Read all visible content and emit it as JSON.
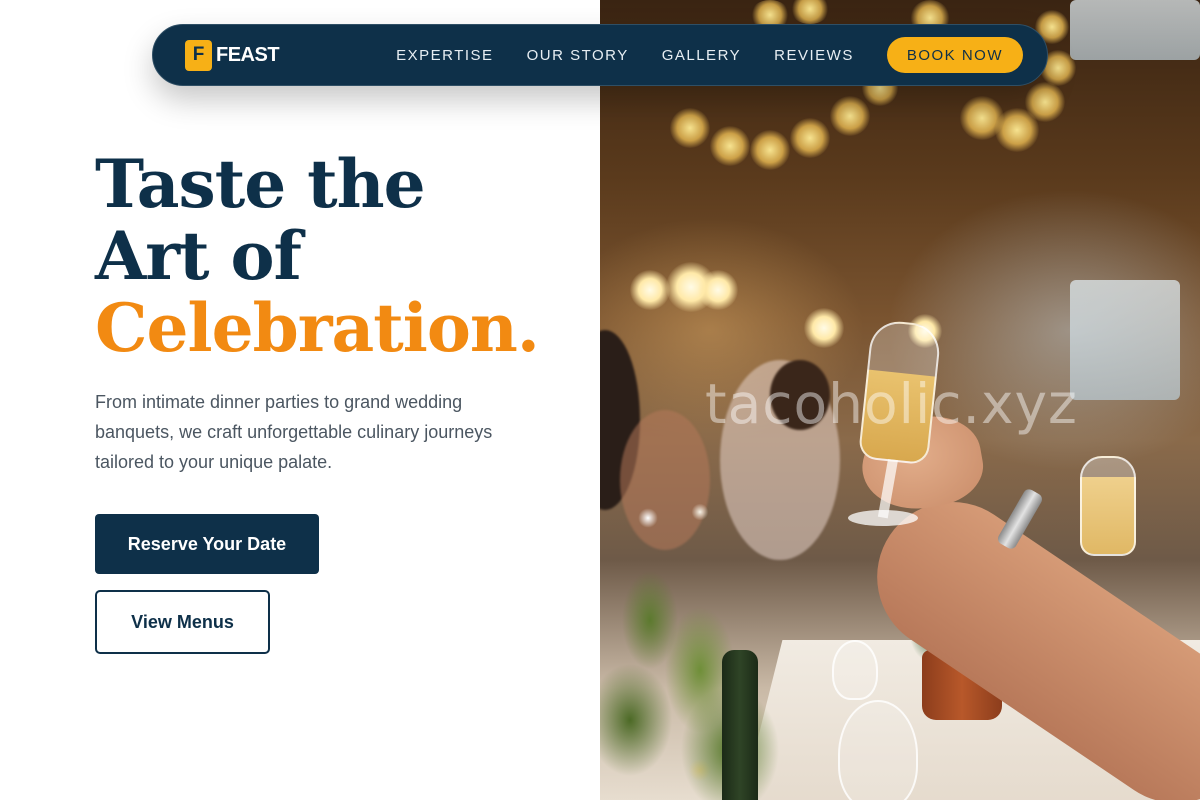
{
  "brand": {
    "logo_letter": "F",
    "name": "FEAST"
  },
  "nav": {
    "links": [
      "EXPERTISE",
      "OUR STORY",
      "GALLERY",
      "REVIEWS"
    ],
    "cta": "BOOK NOW"
  },
  "hero": {
    "title_line1": "Taste the",
    "title_line2": "Art of",
    "title_line3": "Celebration.",
    "description": "From intimate dinner parties to grand wedding banquets, we craft unforgettable culinary journeys tailored to your unique palate.",
    "primary_button": "Reserve Your Date",
    "secondary_button": "View Menus"
  },
  "photo": {
    "watermark": "tacoholic.xyz"
  },
  "colors": {
    "navy": "#0e3049",
    "accent_orange": "#f28a12",
    "accent_yellow": "#f7b016",
    "body_text": "#4b5661"
  },
  "icons": {
    "brand_mark": "letter-badge-icon"
  }
}
